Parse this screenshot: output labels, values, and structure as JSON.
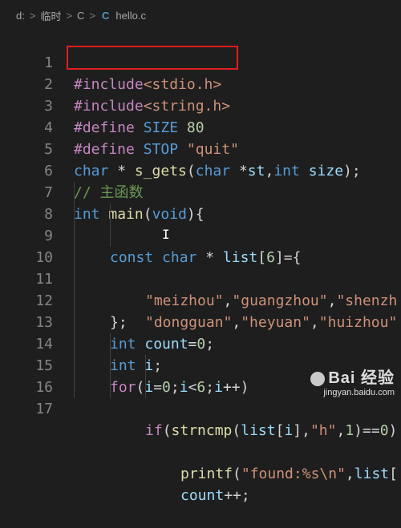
{
  "breadcrumb": {
    "drive": "d:",
    "folder1": "临时",
    "folder2": "C",
    "file_icon": "C",
    "file_name": "hello.c",
    "separator": ">"
  },
  "line_numbers": [
    "1",
    "2",
    "3",
    "4",
    "5",
    "6",
    "7",
    "8",
    "9",
    "10",
    "11",
    "12",
    "13",
    "14",
    "15",
    "16",
    "17"
  ],
  "code": {
    "l1_inc": "#include",
    "l1_hdr": "<stdio.h>",
    "l2_inc": "#include",
    "l2_hdr": "<string.h>",
    "l3_def": "#define",
    "l3_name": "SIZE",
    "l3_val": "80",
    "l4_def": "#define",
    "l4_name": "STOP",
    "l4_val": "\"quit\"",
    "l5_type": "char",
    "l5_a": " * ",
    "l5_fn": "s_gets",
    "l5_b": "(",
    "l5_type2": "char",
    "l5_c": " *",
    "l5_p1": "st",
    "l5_d": ",",
    "l5_type3": "int",
    "l5_e": " ",
    "l5_p2": "size",
    "l5_f": ");",
    "l6_comment": "// 主函数",
    "l7_type": "int",
    "l7_fn": "main",
    "l7_a": "(",
    "l7_void": "void",
    "l7_b": "){",
    "l8_const": "const",
    "l8_char": "char",
    "l8_a": " * ",
    "l8_var": "list",
    "l8_b": "[",
    "l8_num": "6",
    "l8_c": "]={",
    "l9_s1": "\"meizhou\"",
    "l9_s2": "\"guangzhou\"",
    "l9_s3": "\"shenzh",
    "l9_comma": ",",
    "l10_s1": "\"dongguan\"",
    "l10_s2": "\"heyuan\"",
    "l10_s3": "\"huizhou\"",
    "l10_comma": ",",
    "l11": "};",
    "l12_type": "int",
    "l12_var": "count",
    "l12_eq": "=",
    "l12_num": "0",
    "l12_end": ";",
    "l13_type": "int",
    "l13_var": "i",
    "l13_end": ";",
    "l14_for": "for",
    "l14_a": "(",
    "l14_i1": "i",
    "l14_b": "=",
    "l14_n0": "0",
    "l14_c": ";",
    "l14_i2": "i",
    "l14_d": "<",
    "l14_n6": "6",
    "l14_e": ";",
    "l14_i3": "i",
    "l14_f": "++)",
    "l15_if": "if",
    "l15_a": "(",
    "l15_fn": "strncmp",
    "l15_b": "(",
    "l15_var": "list",
    "l15_c": "[",
    "l15_i": "i",
    "l15_d": "],",
    "l15_str": "\"h\"",
    "l15_e": ",",
    "l15_n1": "1",
    "l15_f": ")==",
    "l15_n0": "0",
    "l15_g": ")",
    "l16_fn": "printf",
    "l16_a": "(",
    "l16_str": "\"found:%s\\n\"",
    "l16_b": ",",
    "l16_var": "list",
    "l16_c": "[",
    "l17_var": "count",
    "l17_op": "++;"
  },
  "watermark": {
    "main": "Bai 经验",
    "sub": "jingyan.baidu.com"
  },
  "colors": {
    "highlight_box": "#e01e1e",
    "background": "#1e1e1e"
  }
}
